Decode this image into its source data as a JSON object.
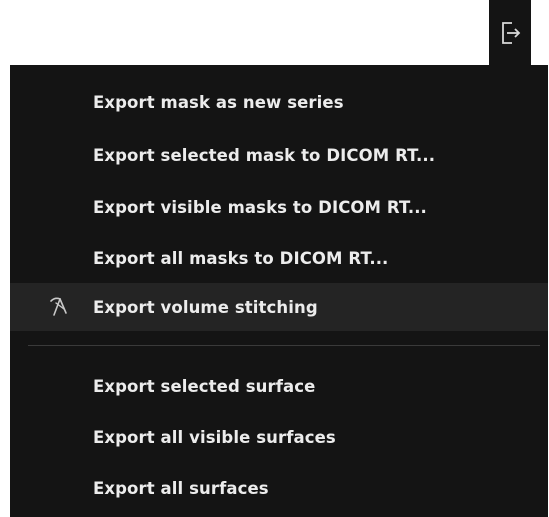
{
  "toolbar": {
    "export_icon": "export-icon"
  },
  "menu": {
    "items": [
      {
        "label": "Export mask as new series",
        "icon": null
      },
      {
        "label": "Export selected mask to DICOM RT...",
        "icon": null
      },
      {
        "label": "Export visible masks to DICOM RT...",
        "icon": null
      },
      {
        "label": "Export all masks to DICOM RT...",
        "icon": null
      },
      {
        "label": "Export volume stitching",
        "icon": "stitching-icon",
        "highlighted": true
      },
      {
        "label": "Export selected surface",
        "icon": null
      },
      {
        "label": "Export all visible surfaces",
        "icon": null
      },
      {
        "label": "Export all surfaces",
        "icon": null
      }
    ]
  },
  "colors": {
    "menu_background": "#141414",
    "highlight_background": "#242424",
    "text": "#ececec",
    "separator": "#3a3a3a"
  }
}
